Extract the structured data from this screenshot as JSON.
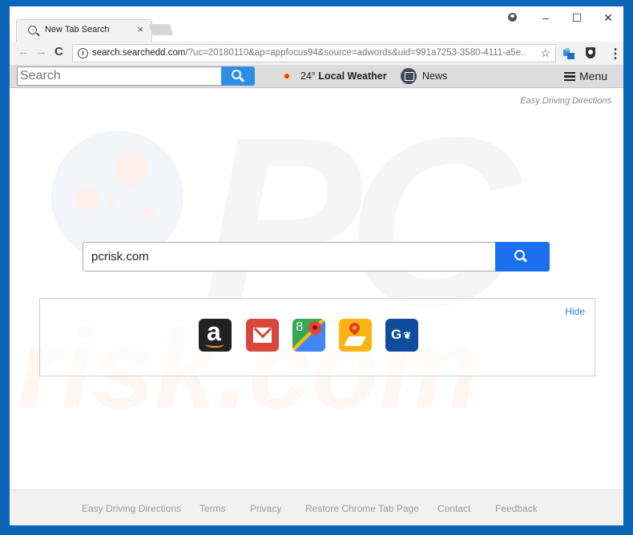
{
  "browser": {
    "tab": {
      "title": "New Tab Search",
      "close_glyph": "×"
    },
    "window_controls": {
      "minimize": "–",
      "maximize": "☐",
      "close": "✕"
    },
    "nav": {
      "back": "←",
      "forward": "→",
      "reload": "C"
    },
    "address_bar": {
      "host": "search.searchedd.com",
      "path": "/?uc=20180110&ap=appfocus94&source=adwords&uid=991a7253-3580-4111-a5e...",
      "info_glyph": "i",
      "star_glyph": "☆"
    },
    "menu_glyph": "⋮"
  },
  "page_toolbar": {
    "search_placeholder": "Search",
    "weather": {
      "temp": "24°",
      "label": "Local Weather"
    },
    "news_label": "News",
    "menu_label": "Menu"
  },
  "content": {
    "top_link": "Easy Driving Directions",
    "main_search": {
      "value": "pcrisk.com"
    },
    "shortcuts": {
      "hide_label": "Hide",
      "items": [
        {
          "name": "Amazon",
          "glyph": "a"
        },
        {
          "name": "Gmail"
        },
        {
          "name": "Google Maps",
          "glyph": "8"
        },
        {
          "name": "Easy Driving Directions"
        },
        {
          "name": "Gas Stations",
          "glyph": "G̵"
        }
      ]
    },
    "watermark": {
      "top": "PC",
      "bottom": "risk.com"
    }
  },
  "footer": {
    "links": [
      "Easy Driving Directions",
      "Terms",
      "Privacy",
      "Restore Chrome Tab Page",
      "Contact",
      "Feedback"
    ]
  },
  "colors": {
    "frame_blue": "#0a64b8",
    "search_button": "#1a6ff0",
    "toolbar_search_button": "#2f8de4",
    "hide_link": "#2e7ec8"
  }
}
